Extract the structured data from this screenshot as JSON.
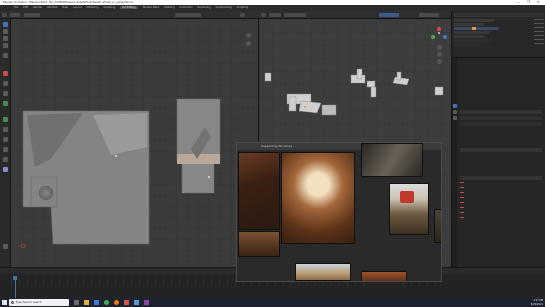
{
  "window": {
    "title": "Blender [C:\\Users\\...\\Blender\\2021_Fan_Art\\NEW\\Desert_streets\\Final\\Desert_street_uv_guide.blend]",
    "controls": "—  ❐  ✕"
  },
  "menubar": {
    "items": [
      "File",
      "Edit",
      "Render",
      "Window",
      "Help"
    ],
    "workspaces": [
      "Layout",
      "Modeling",
      "Sculpting",
      "UV Editing",
      "Texture Paint",
      "Shading",
      "Animation",
      "Rendering",
      "Compositing",
      "Scripting"
    ],
    "active_workspace": "UV Editing"
  },
  "reference_window": {
    "title": "Supporting Structure"
  },
  "taskbar": {
    "search_placeholder": "Type here to search",
    "time": "4:17 PM",
    "date": "6/29/2021"
  },
  "colors": {
    "accent": "#4772b3",
    "active_frame": "#4772b3",
    "object_orange": "#e09a3a"
  },
  "icons": [
    "windows-start-icon",
    "search-icon",
    "cursor-tool-icon",
    "move-tool-icon",
    "camera-icon",
    "lamp-icon",
    "wrench-icon",
    "folder-icon",
    "mail-icon",
    "chrome-icon",
    "blender-icon"
  ]
}
